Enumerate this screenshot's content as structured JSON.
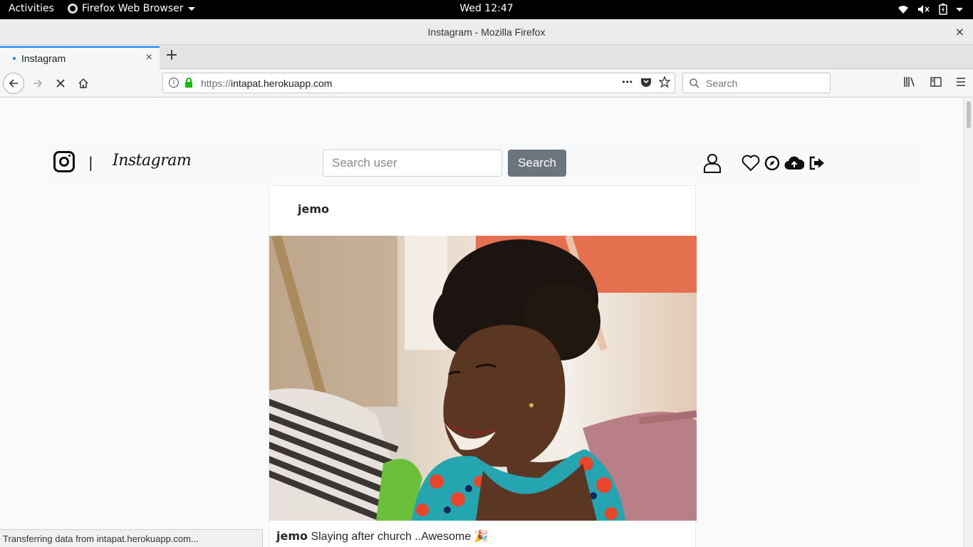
{
  "gnome": {
    "activities": "Activities",
    "app_name": "Firefox Web Browser",
    "clock": "Wed 12:47"
  },
  "window": {
    "title": "Instagram - Mozilla Firefox",
    "close": "×"
  },
  "tabs": [
    {
      "label": "Instagram",
      "loading": true
    }
  ],
  "newtab": "+",
  "urlbar": {
    "scheme": "https://",
    "host": "intapat.herokuapp.com",
    "more": "•••"
  },
  "searchbar": {
    "placeholder": "Search"
  },
  "instagram": {
    "separator": "|",
    "wordmark": "Instagram",
    "search_placeholder": "Search user",
    "search_button": "Search",
    "post": {
      "username": "jemo",
      "caption_user": "jemo",
      "caption_text": "Slaying after church ..Awesome 🎉"
    }
  },
  "status": "Transferring data from intapat.herokuapp.com...",
  "colors": {
    "accent": "#0a84ff",
    "search_button": "#6c757d",
    "gnome_bar": "#000000"
  }
}
